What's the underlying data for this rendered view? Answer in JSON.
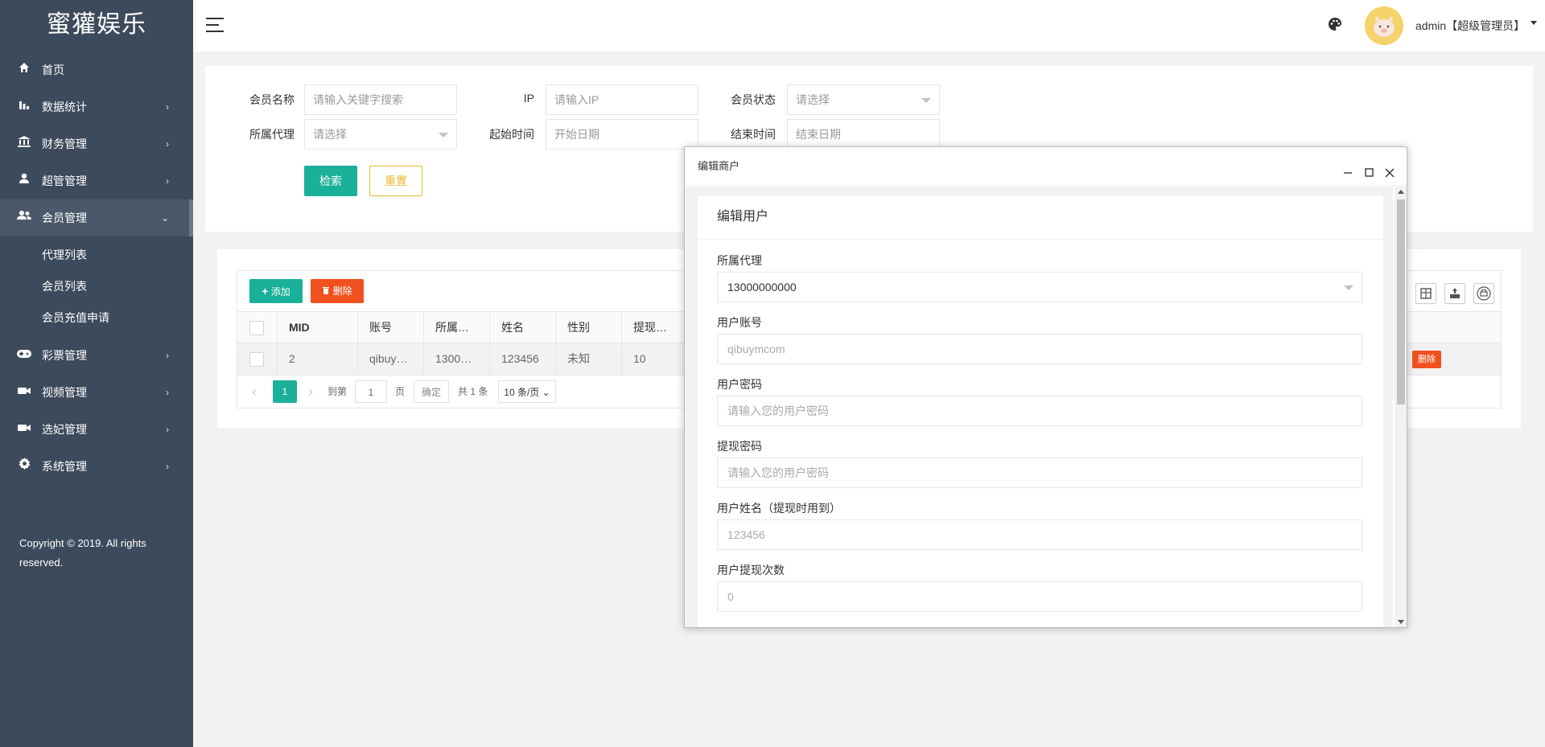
{
  "brand": {
    "logo_text": "蜜獾娱乐"
  },
  "sidebar": {
    "items": [
      {
        "label": "首页",
        "icon": "home-icon"
      },
      {
        "label": "数据统计",
        "icon": "bar-chart-icon"
      },
      {
        "label": "财务管理",
        "icon": "bank-icon"
      },
      {
        "label": "超管管理",
        "icon": "user-icon"
      },
      {
        "label": "会员管理",
        "icon": "users-icon"
      },
      {
        "label": "彩票管理",
        "icon": "gamepad-icon"
      },
      {
        "label": "视频管理",
        "icon": "video-icon"
      },
      {
        "label": "选妃管理",
        "icon": "video-icon"
      },
      {
        "label": "系统管理",
        "icon": "gear-icon"
      }
    ],
    "sub_items": [
      {
        "label": "代理列表"
      },
      {
        "label": "会员列表"
      },
      {
        "label": "会员充值申请"
      }
    ],
    "copyright": "Copyright © 2019. All rights reserved."
  },
  "header": {
    "user_label": "admin【超级管理员】"
  },
  "search": {
    "member_name_label": "会员名称",
    "member_name_placeholder": "请输入关键字搜索",
    "ip_label": "IP",
    "ip_placeholder": "请输入IP",
    "status_label": "会员状态",
    "status_value": "请选择",
    "agent_label": "所属代理",
    "agent_value": "请选择",
    "start_label": "起始时间",
    "start_placeholder": "开始日期",
    "end_label": "结束时间",
    "end_placeholder": "结束日期",
    "search_button": "检索",
    "reset_button": "重置"
  },
  "table": {
    "add_button": "添加",
    "delete_button": "删除",
    "columns": [
      "MID",
      "账号",
      "所属…",
      "姓名",
      "性别",
      "提现…"
    ],
    "rows": [
      {
        "mid": "2",
        "account": "qibuy…",
        "agent": "1300…",
        "name": "123456",
        "gender": "未知",
        "withdraw": "10",
        "action": "删除"
      }
    ],
    "pager": {
      "current": "1",
      "goto_label": "到第",
      "goto_value": "1",
      "page_label": "页",
      "confirm": "确定",
      "total": "共 1 条",
      "per_page": "10 条/页"
    }
  },
  "modal": {
    "window_title": "编辑商户",
    "card_title": "编辑用户",
    "fields": [
      {
        "label": "所属代理",
        "value": "13000000000",
        "placeholder": ""
      },
      {
        "label": "用户账号",
        "value": "",
        "placeholder": "qibuymcom"
      },
      {
        "label": "用户密码",
        "value": "",
        "placeholder": "请输入您的用户密码"
      },
      {
        "label": "提现密码",
        "value": "",
        "placeholder": "请输入您的用户密码"
      },
      {
        "label": "用户姓名（提现时用到）",
        "value": "",
        "placeholder": "123456"
      },
      {
        "label": "用户提现次数",
        "value": "",
        "placeholder": "0"
      }
    ]
  },
  "colors": {
    "sidebar_bg": "#3d4a5c",
    "primary": "#1ab09a",
    "danger": "#f0511f",
    "warning": "#e8b82c"
  }
}
